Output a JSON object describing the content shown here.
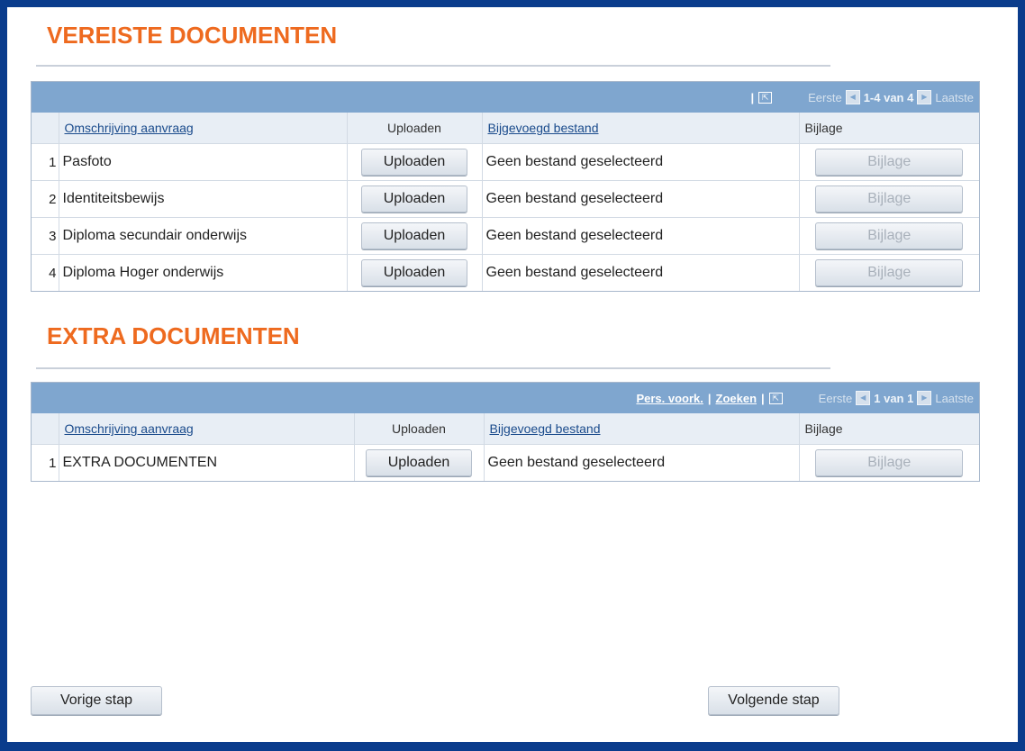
{
  "required": {
    "title": "VEREISTE DOCUMENTEN",
    "grid": {
      "first_label": "Eerste",
      "range": "1-4 van 4",
      "last_label": "Laatste",
      "columns": [
        "Omschrijving aanvraag",
        "Uploaden",
        "Bijgevoegd bestand",
        "Bijlage"
      ],
      "rows": [
        {
          "num": "1",
          "description": "Pasfoto",
          "upload_label": "Uploaden",
          "file": "Geen bestand geselecteerd",
          "attachment_label": "Bijlage"
        },
        {
          "num": "2",
          "description": "Identiteitsbewijs",
          "upload_label": "Uploaden",
          "file": "Geen bestand geselecteerd",
          "attachment_label": "Bijlage"
        },
        {
          "num": "3",
          "description": "Diploma secundair onderwijs",
          "upload_label": "Uploaden",
          "file": "Geen bestand geselecteerd",
          "attachment_label": "Bijlage"
        },
        {
          "num": "4",
          "description": "Diploma Hoger onderwijs",
          "upload_label": "Uploaden",
          "file": "Geen bestand geselecteerd",
          "attachment_label": "Bijlage"
        }
      ]
    }
  },
  "extra": {
    "title": "EXTRA DOCUMENTEN",
    "grid": {
      "personalize_link": "Pers. voork.",
      "search_link": "Zoeken",
      "first_label": "Eerste",
      "range": "1 van 1",
      "last_label": "Laatste",
      "columns": [
        "Omschrijving aanvraag",
        "Uploaden",
        "Bijgevoegd bestand",
        "Bijlage"
      ],
      "rows": [
        {
          "num": "1",
          "description": "EXTRA DOCUMENTEN",
          "upload_label": "Uploaden",
          "file": "Geen bestand geselecteerd",
          "attachment_label": "Bijlage"
        }
      ]
    }
  },
  "footer": {
    "prev_label": "Vorige stap",
    "next_label": "Volgende stap"
  },
  "colors": {
    "accent_orange": "#ee6a1f",
    "frame_blue": "#0a3c8c",
    "grid_header_blue": "#7fa6cf"
  },
  "icons": {
    "popout": "new-window-icon",
    "prev": "previous-page-icon",
    "next": "next-page-icon"
  }
}
